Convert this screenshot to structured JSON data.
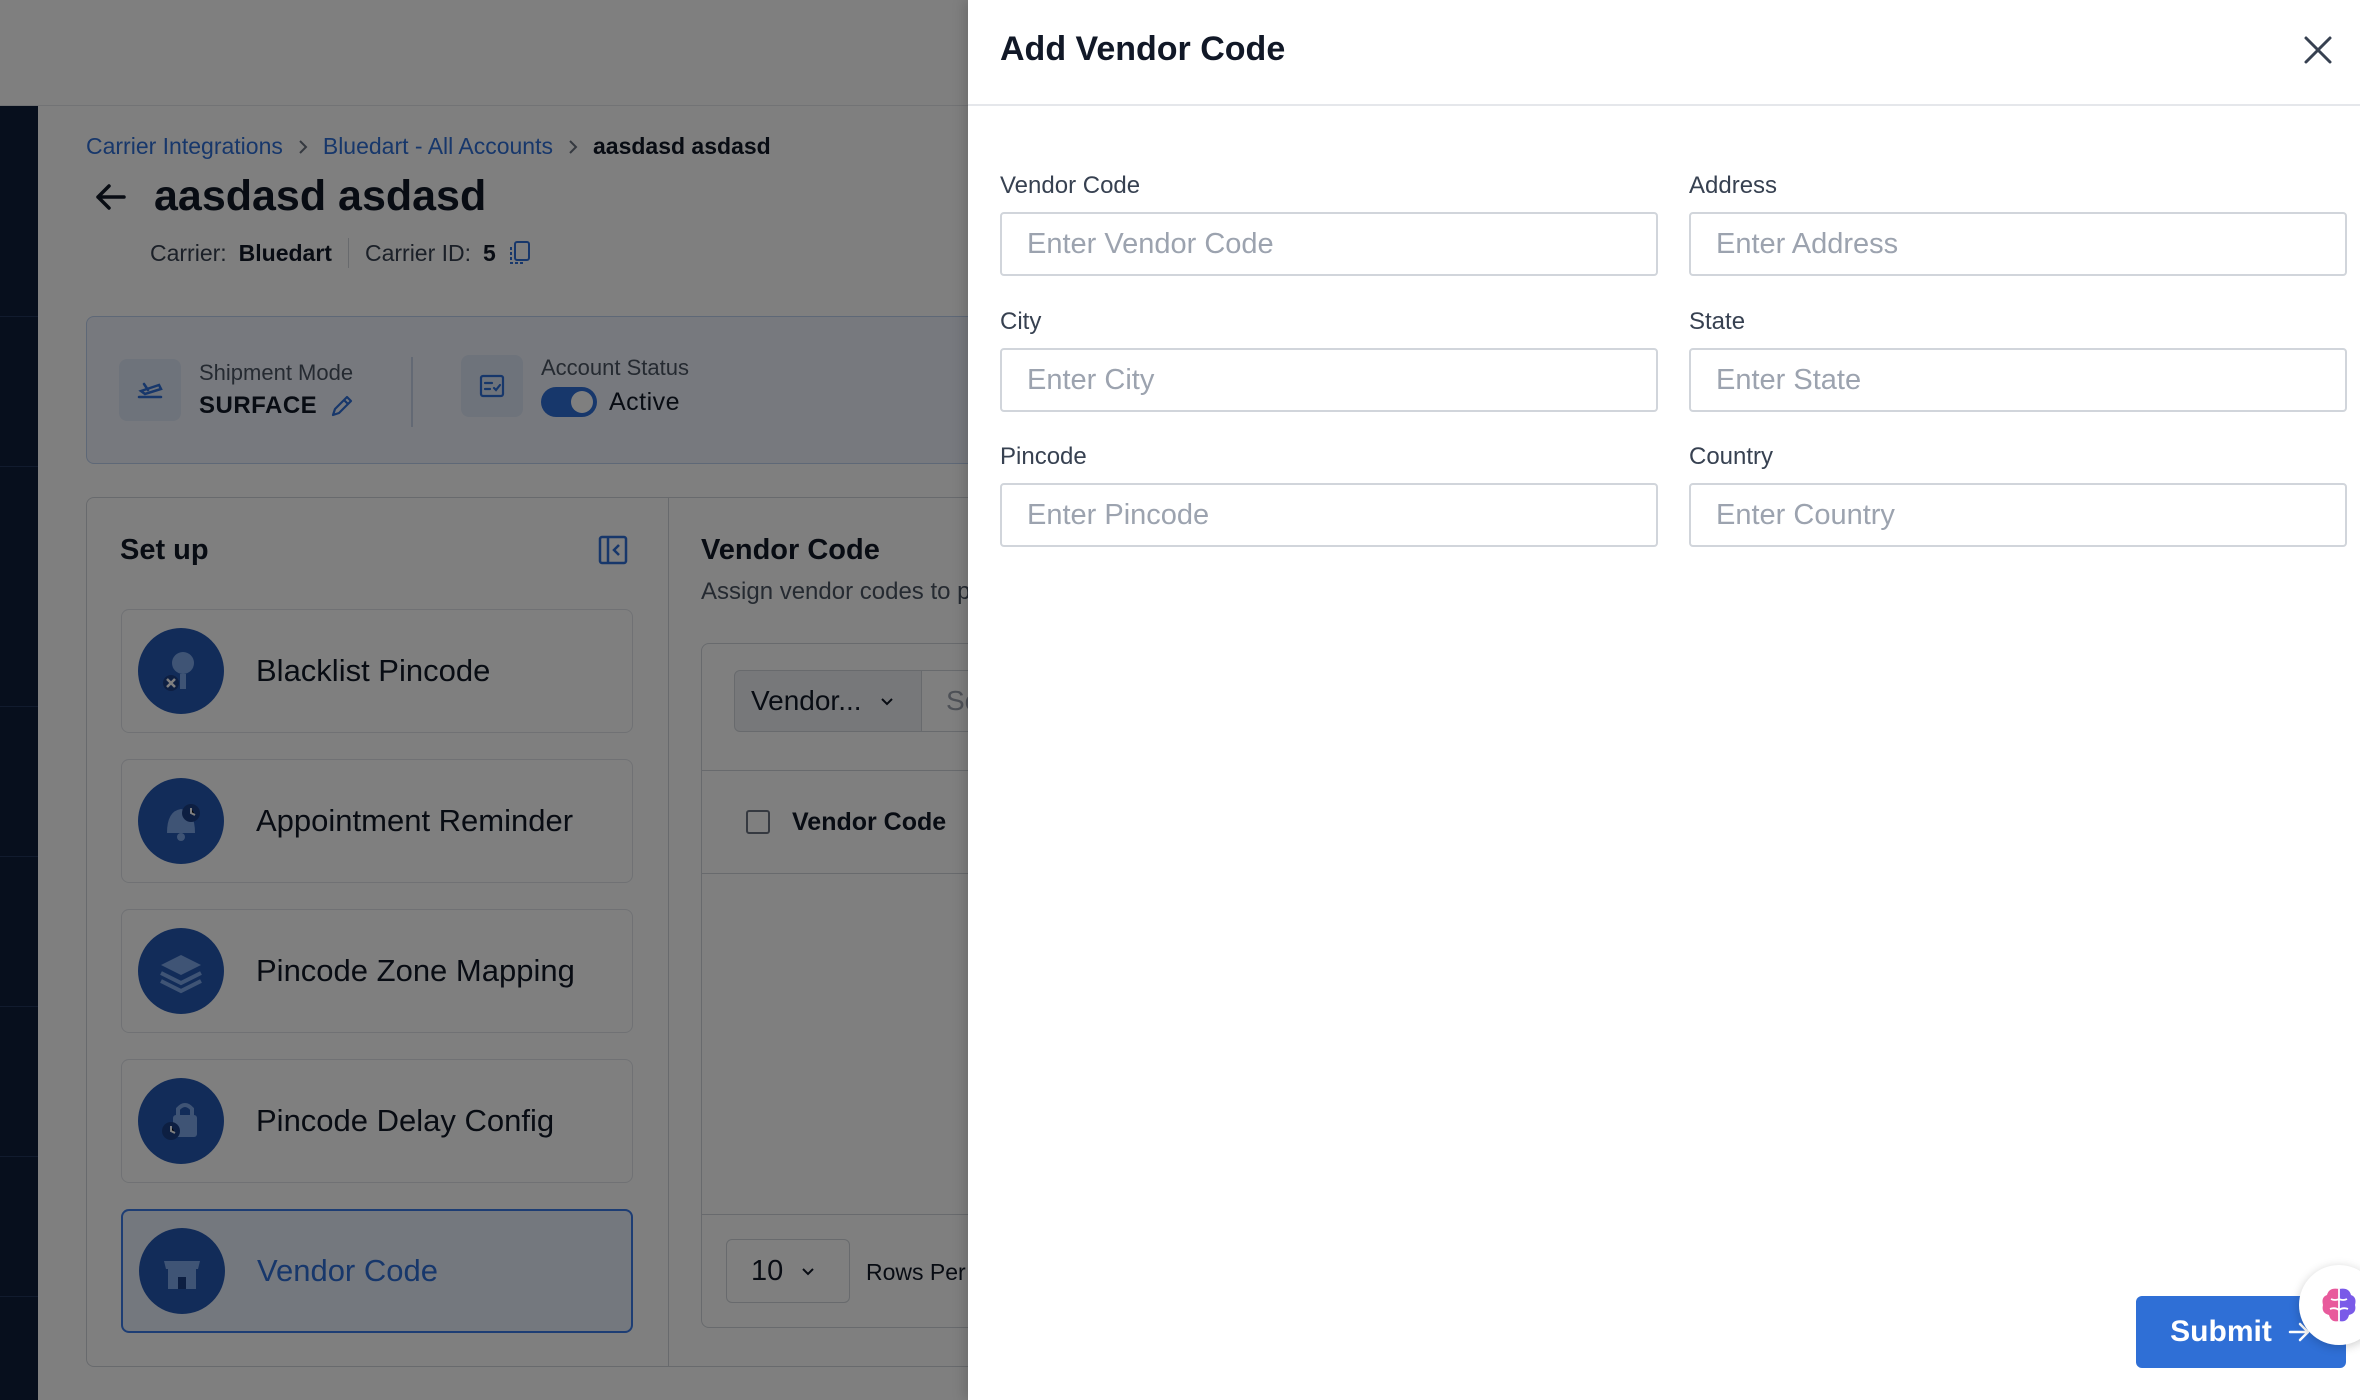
{
  "breadcrumb": {
    "items": [
      "Carrier Integrations",
      "Bluedart - All Accounts"
    ],
    "current": "aasdasd asdasd"
  },
  "account": {
    "title": "aasdasd asdasd",
    "carrier_label": "Carrier:",
    "carrier_value": "Bluedart",
    "carrier_id_label": "Carrier ID:",
    "carrier_id_value": "5"
  },
  "info": {
    "shipment_mode_label": "Shipment Mode",
    "shipment_mode_value": "SURFACE",
    "account_status_label": "Account Status",
    "account_status_value": "Active"
  },
  "setup": {
    "title": "Set up",
    "items": [
      {
        "label": "Blacklist Pincode",
        "icon": "blacklist-pincode-icon"
      },
      {
        "label": "Appointment Reminder",
        "icon": "appointment-reminder-icon"
      },
      {
        "label": "Pincode Zone Mapping",
        "icon": "pincode-zone-mapping-icon"
      },
      {
        "label": "Pincode Delay Config",
        "icon": "pincode-delay-config-icon"
      },
      {
        "label": "Vendor Code",
        "icon": "vendor-code-icon",
        "active": true
      }
    ]
  },
  "vendor_panel": {
    "title": "Vendor Code",
    "subtitle": "Assign vendor codes to p",
    "filter_value": "Vendor...",
    "search_stub": "Se",
    "column_header": "Vendor Code",
    "rows_per_page_value": "10",
    "rows_per_page_label": "Rows Per"
  },
  "drawer": {
    "title": "Add Vendor Code",
    "fields": {
      "vendor_code": {
        "label": "Vendor Code",
        "placeholder": "Enter Vendor Code"
      },
      "address": {
        "label": "Address",
        "placeholder": "Enter Address"
      },
      "city": {
        "label": "City",
        "placeholder": "Enter City"
      },
      "state": {
        "label": "State",
        "placeholder": "Enter State"
      },
      "pincode": {
        "label": "Pincode",
        "placeholder": "Enter Pincode"
      },
      "country": {
        "label": "Country",
        "placeholder": "Enter Country"
      }
    },
    "submit_label": "Submit"
  },
  "colors": {
    "accent": "#2f6fd6",
    "sidebar": "#0f1f3a",
    "icon_circle": "#2458b3"
  }
}
